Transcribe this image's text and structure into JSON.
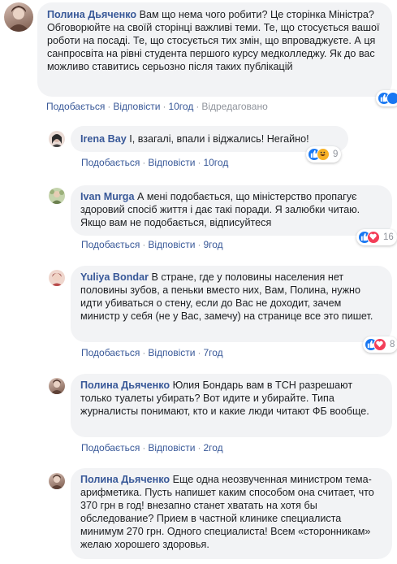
{
  "comments": [
    {
      "author": "Полина Дьяченко",
      "text": "Вам що нема чого робити? Це сторінка Міністра? Обговорюйте на своїй сторінці важливі теми. Те, що стосується вашої роботи на посаді. Те, що стосується тих змін, що впроваджуєте. А ця санпросвіта на рівні студента першого курсу медколледжу. Як до вас можливо ставитись серьозно після таких публікацій",
      "like": "Подобається",
      "reply": "Відповісти",
      "time": "10год",
      "edited": "Відредаговано",
      "reactions": [],
      "reaction_count": "",
      "avatar_colors": [
        "#c7a89a",
        "#6e4f43"
      ]
    },
    {
      "author": "Irena Bay",
      "text": "І, взагалі, впали і віджались! Негайно!",
      "like": "Подобається",
      "reply": "Відповісти",
      "time": "10год",
      "edited": "",
      "reactions": [
        "like-icon",
        "haha-icon"
      ],
      "reaction_count": "9",
      "avatar_colors": [
        "#e8d9d4",
        "#333333"
      ]
    },
    {
      "author": "Ivan Murga",
      "text": "А мені подобається, що міністерство пропагує здоровий спосіб життя і дає такі поради. Я залюбки читаю. Якщо вам не подобається, відписуйтеся",
      "like": "Подобається",
      "reply": "Відповісти",
      "time": "9год",
      "edited": "",
      "reactions": [
        "like-icon",
        "love-icon"
      ],
      "reaction_count": "16",
      "avatar_colors": [
        "#b8c9a0",
        "#7a8f5a"
      ]
    },
    {
      "author": "Yuliya Bondar",
      "text": "В стране, где у половины населения нет половины зубов, а пеньки вместо них, Вам, Полина, нужно идти убиваться о стену, если до Вас не доходит, зачем министр у себя (не у Вас, замечу) на странице все это пишет.",
      "like": "Подобається",
      "reply": "Відповісти",
      "time": "7год",
      "edited": "",
      "reactions": [
        "like-icon",
        "love-icon"
      ],
      "reaction_count": "8",
      "avatar_colors": [
        "#e6c2b8",
        "#a03a3a"
      ]
    },
    {
      "author": "Полина Дьяченко",
      "text": "Юлия Бондарь вам в ТСН разрешают только туалеты убирать? Вот идите и убирайте. Типа журналисты понимают, кто и какие люди читают ФБ вообще.",
      "like": "Подобається",
      "reply": "Відповісти",
      "time": "2год",
      "edited": "",
      "reactions": [],
      "reaction_count": "",
      "avatar_colors": [
        "#c7a89a",
        "#6e4f43"
      ]
    },
    {
      "author": "Полина Дьяченко",
      "text": "Еще одна неозвученная министром тема-арифметика. Пусть напишет каким способом она считает, что 370 грн в год! внезапно станет хватать на хотя бы обследование? Прием в частной клинике специалиста минимум 270 грн. Одного специалиста! Всем «сторонникам» желаю хорошего здоровья.",
      "like": "",
      "reply": "",
      "time": "",
      "edited": "",
      "reactions": [],
      "reaction_count": "",
      "avatar_colors": [
        "#c7a89a",
        "#6e4f43"
      ]
    }
  ],
  "colors": {
    "author": "#385898",
    "bubble": "#f2f3f5",
    "like_icon": "#1877f2",
    "love_icon": "#f33e58",
    "haha_icon": "#f7b125"
  }
}
